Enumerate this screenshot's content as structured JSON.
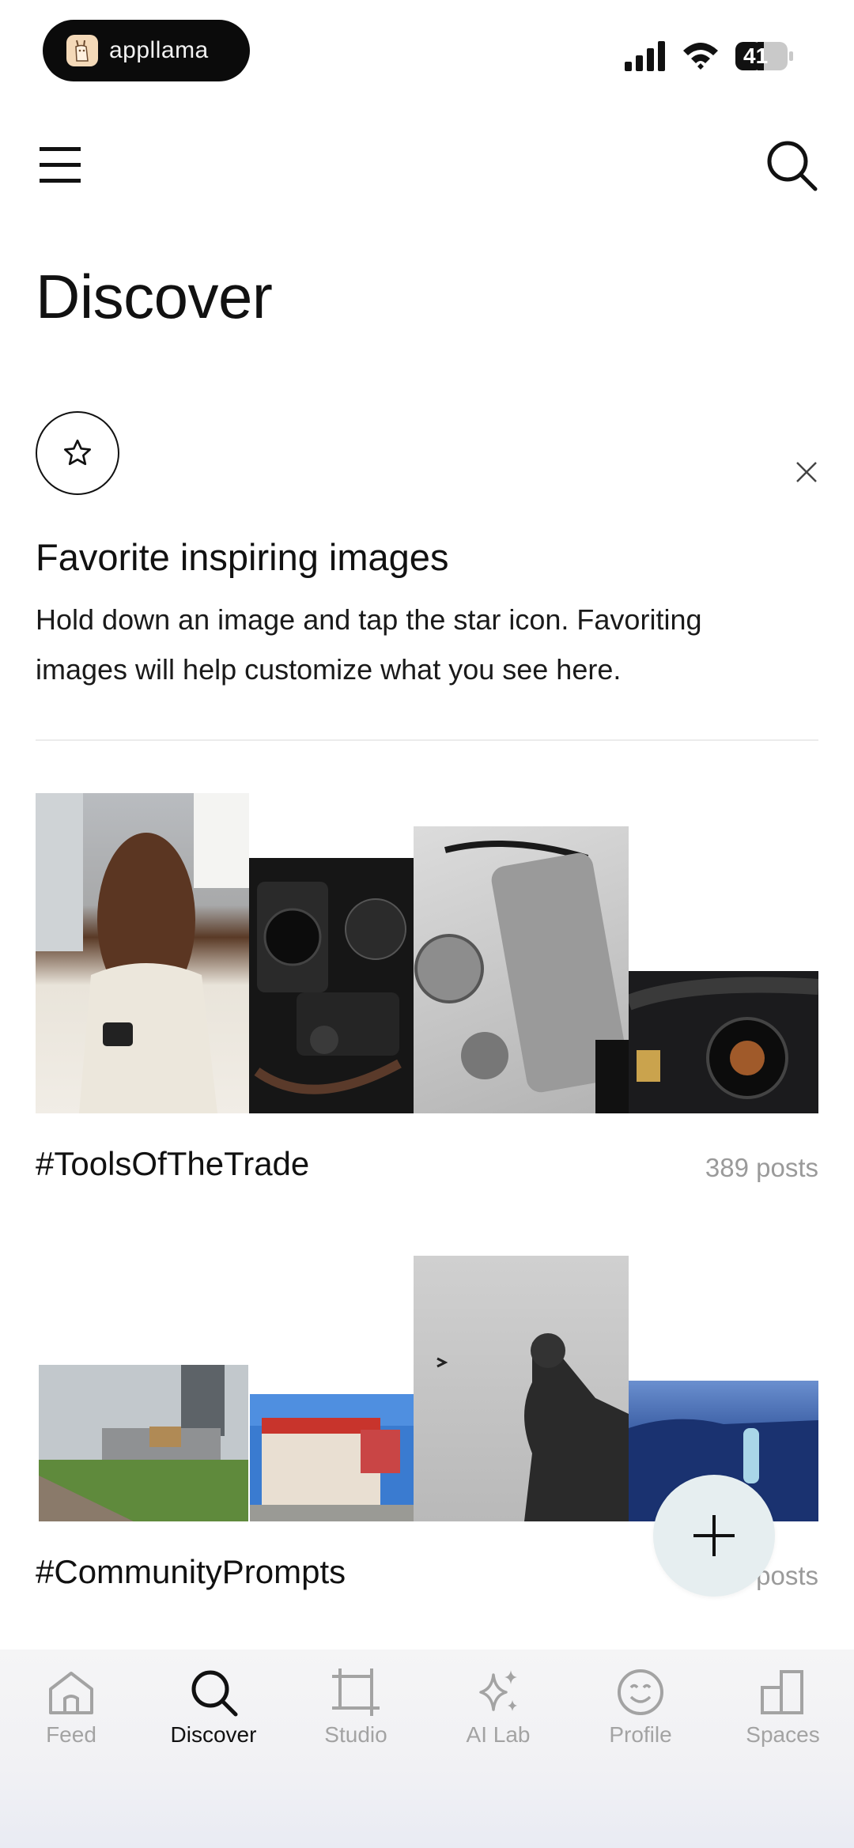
{
  "status_bar": {
    "app_name": "appllama",
    "battery": "41"
  },
  "header": {
    "title": "Discover"
  },
  "tip": {
    "title": "Favorite inspiring images",
    "body": "Hold down an image and tap the star icon. Favoriting images will help customize what you see here."
  },
  "collections": [
    {
      "tag": "#ToolsOfTheTrade",
      "count": "389 posts"
    },
    {
      "tag": "#CommunityPrompts",
      "count": "posts"
    }
  ],
  "nav": {
    "items": [
      {
        "label": "Feed",
        "icon": "home-icon"
      },
      {
        "label": "Discover",
        "icon": "search-icon"
      },
      {
        "label": "Studio",
        "icon": "crop-icon"
      },
      {
        "label": "AI Lab",
        "icon": "sparkle-icon"
      },
      {
        "label": "Profile",
        "icon": "smiley-icon"
      },
      {
        "label": "Spaces",
        "icon": "spaces-icon"
      }
    ],
    "active": "Discover"
  },
  "colors": {
    "text": "#111111",
    "muted": "#9a9a9a",
    "fab_bg": "#e6eef0"
  }
}
